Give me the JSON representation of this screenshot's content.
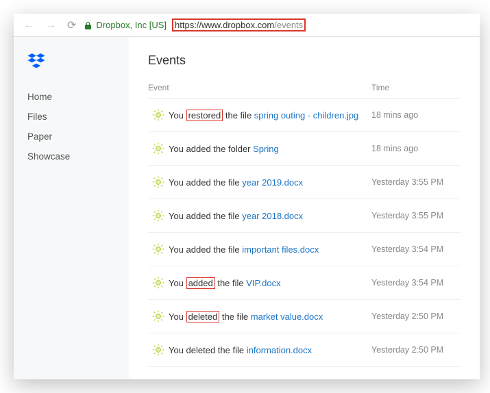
{
  "browser": {
    "secure_label": "Dropbox, Inc [US]",
    "url_host": "https://www.dropbox.com",
    "url_path": "/events"
  },
  "sidebar": {
    "items": [
      {
        "label": "Home"
      },
      {
        "label": "Files"
      },
      {
        "label": "Paper"
      },
      {
        "label": "Showcase"
      }
    ]
  },
  "page": {
    "title": "Events",
    "col_event": "Event",
    "col_time": "Time"
  },
  "events": [
    {
      "prefix": "You ",
      "verb": "restored",
      "verb_boxed": true,
      "mid": " the file ",
      "target": "spring outing - children.jpg",
      "time": "18 mins ago"
    },
    {
      "prefix": "You added the folder ",
      "verb": "",
      "verb_boxed": false,
      "mid": "",
      "target": "Spring",
      "time": "18 mins ago"
    },
    {
      "prefix": "You added the file ",
      "verb": "",
      "verb_boxed": false,
      "mid": "",
      "target": "year 2019.docx",
      "time": "Yesterday 3:55 PM"
    },
    {
      "prefix": "You added the file ",
      "verb": "",
      "verb_boxed": false,
      "mid": "",
      "target": "year 2018.docx",
      "time": "Yesterday 3:55 PM"
    },
    {
      "prefix": "You added the file ",
      "verb": "",
      "verb_boxed": false,
      "mid": "",
      "target": "important files.docx",
      "time": "Yesterday 3:54 PM"
    },
    {
      "prefix": "You ",
      "verb": "added",
      "verb_boxed": true,
      "mid": " the file ",
      "target": "VIP.docx",
      "time": "Yesterday 3:54 PM"
    },
    {
      "prefix": "You ",
      "verb": "deleted",
      "verb_boxed": true,
      "mid": " the file ",
      "target": "market value.docx",
      "time": "Yesterday 2:50 PM"
    },
    {
      "prefix": "You deleted the file ",
      "verb": "",
      "verb_boxed": false,
      "mid": "",
      "target": "information.docx",
      "time": "Yesterday 2:50 PM"
    }
  ]
}
